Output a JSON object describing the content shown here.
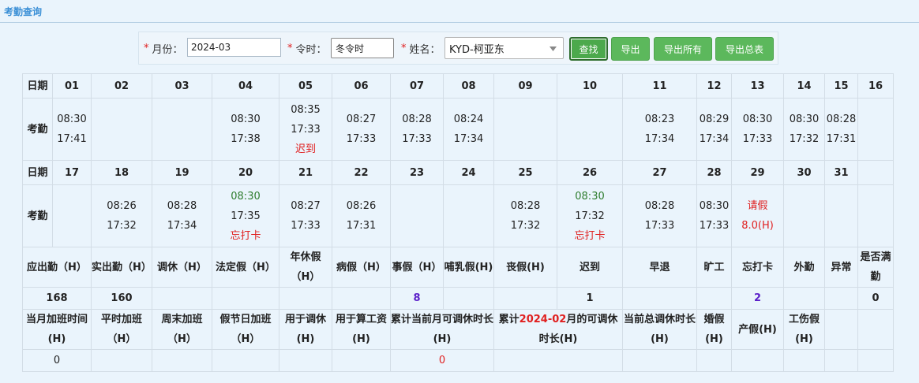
{
  "title": "考勤查询",
  "toolbar": {
    "month_label": "月份：",
    "month_value": "2024-03",
    "season_label": "令时：",
    "season_value": "冬令时",
    "name_label": "姓名：",
    "name_value": "KYD-柯亚东",
    "search_btn": "查找",
    "export_btn": "导出",
    "export_all_btn": "导出所有",
    "export_summary_btn": "导出总表",
    "required_mark": "*"
  },
  "row_labels": {
    "date": "日期",
    "attendance": "考勤"
  },
  "days": [
    {
      "day": "01",
      "in": "08:30",
      "out": "17:41",
      "note": ""
    },
    {
      "day": "02",
      "in": "",
      "out": "",
      "note": ""
    },
    {
      "day": "03",
      "in": "",
      "out": "",
      "note": ""
    },
    {
      "day": "04",
      "in": "08:30",
      "out": "17:38",
      "note": ""
    },
    {
      "day": "05",
      "in": "08:35",
      "out": "17:33",
      "note": "迟到"
    },
    {
      "day": "06",
      "in": "08:27",
      "out": "17:33",
      "note": ""
    },
    {
      "day": "07",
      "in": "08:28",
      "out": "17:33",
      "note": ""
    },
    {
      "day": "08",
      "in": "08:24",
      "out": "17:34",
      "note": ""
    },
    {
      "day": "09",
      "in": "",
      "out": "",
      "note": ""
    },
    {
      "day": "10",
      "in": "",
      "out": "",
      "note": ""
    },
    {
      "day": "11",
      "in": "08:23",
      "out": "17:34",
      "note": ""
    },
    {
      "day": "12",
      "in": "08:29",
      "out": "17:34",
      "note": ""
    },
    {
      "day": "13",
      "in": "08:30",
      "out": "17:33",
      "note": ""
    },
    {
      "day": "14",
      "in": "08:30",
      "out": "17:32",
      "note": ""
    },
    {
      "day": "15",
      "in": "08:28",
      "out": "17:31",
      "note": ""
    },
    {
      "day": "16",
      "in": "",
      "out": "",
      "note": ""
    },
    {
      "day": "17",
      "in": "",
      "out": "",
      "note": ""
    },
    {
      "day": "18",
      "in": "08:26",
      "out": "17:32",
      "note": ""
    },
    {
      "day": "19",
      "in": "08:28",
      "out": "17:34",
      "note": ""
    },
    {
      "day": "20",
      "in": "08:30",
      "out": "17:35",
      "note": "忘打卡"
    },
    {
      "day": "21",
      "in": "08:27",
      "out": "17:33",
      "note": ""
    },
    {
      "day": "22",
      "in": "08:26",
      "out": "17:31",
      "note": ""
    },
    {
      "day": "23",
      "in": "",
      "out": "",
      "note": ""
    },
    {
      "day": "24",
      "in": "",
      "out": "",
      "note": ""
    },
    {
      "day": "25",
      "in": "08:28",
      "out": "17:32",
      "note": ""
    },
    {
      "day": "26",
      "in": "08:30",
      "out": "17:32",
      "note": "忘打卡"
    },
    {
      "day": "27",
      "in": "08:28",
      "out": "17:33",
      "note": ""
    },
    {
      "day": "28",
      "in": "08:30",
      "out": "17:33",
      "note": ""
    },
    {
      "day": "29",
      "in": "请假",
      "out": "8.0(H)",
      "note": ""
    },
    {
      "day": "30",
      "in": "",
      "out": "",
      "note": ""
    },
    {
      "day": "31",
      "in": "",
      "out": "",
      "note": ""
    }
  ],
  "summary1": {
    "headers": [
      "应出勤（H）",
      "实出勤（H）",
      "调休（H）",
      "法定假（H）",
      "年休假（H）",
      "病假（H）",
      "事假（H）",
      "哺乳假(H)",
      "丧假(H)",
      "迟到",
      "早退",
      "旷工",
      "忘打卡",
      "外勤",
      "异常",
      "是否满勤"
    ],
    "values": [
      "168",
      "160",
      "",
      "",
      "",
      "",
      "8",
      "",
      "",
      "1",
      "",
      "",
      "2",
      "",
      "",
      "0"
    ]
  },
  "summary2": {
    "headers": [
      "当月加班时间(H)",
      "平时加班（H）",
      "周末加班（H）",
      "假节日加班（H）",
      "用于调休(H)",
      "用于算工资(H)",
      "累计当前月可调休时长(H)",
      "累计",
      "2024-02",
      "月的可调休时长(H)",
      "当前总调休时长(H)",
      "婚假(H)",
      "产假(H)",
      "工伤假(H)",
      "",
      ""
    ],
    "values": [
      "0",
      "",
      "",
      "",
      "",
      "",
      "0",
      "",
      "",
      "",
      "",
      "",
      ""
    ]
  }
}
